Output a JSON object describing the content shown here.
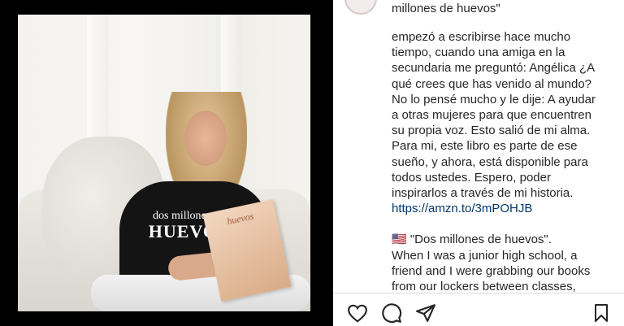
{
  "media": {
    "shirt_line1": "dos millones de",
    "shirt_line2": "HUEVOS",
    "book_title": "huevos"
  },
  "caption": {
    "header_tail": "millones de huevos\"",
    "spanish": "empezó a escribirse hace mucho\ntiempo, cuando una amiga en la\nsecundaria me preguntó: Angélica ¿A\nqué crees que has venido al mundo?\nNo lo pensé mucho y le dije: A ayudar\na otras mujeres para que encuentren\nsu propia voz. Esto salió de mi alma.\nPara mi, este libro es parte de ese\nsueño, y ahora, está disponible para\ntodos ustedes. Espero, poder\ninspirarlos a través de mi historia.",
    "link": "https://amzn.to/3mPOHJB",
    "flag": "🇺🇸",
    "english": "\"Dos millones de huevos\".\nWhen I was a junior high school, a\nfriend and I were grabbing our books\nfrom our lockers between classes,"
  },
  "actions": {
    "like_icon": "heart-icon",
    "comment_icon": "comment-icon",
    "share_icon": "share-icon",
    "save_icon": "bookmark-icon"
  }
}
